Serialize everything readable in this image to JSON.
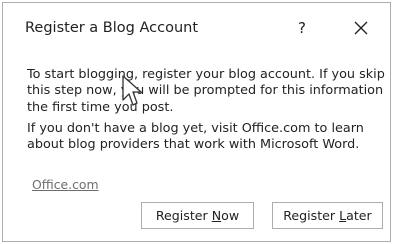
{
  "dialog": {
    "title": "Register a Blog Account",
    "help_label": "?",
    "close_icon": "close-icon",
    "paragraph_1": "To start blogging, register your blog account. If you skip this step now, you will be prompted for this information the first time you post.",
    "paragraph_2": "If you don't have a blog yet, visit Office.com to learn about blog providers that work with Microsoft Word.",
    "link_text": "Office.com",
    "buttons": {
      "register_now": {
        "before": "Register ",
        "mnemonic": "N",
        "after": "ow"
      },
      "register_later": {
        "before": "Register ",
        "mnemonic": "L",
        "after": "ater"
      }
    }
  },
  "cursor_icon": "pointer-arrow-icon"
}
